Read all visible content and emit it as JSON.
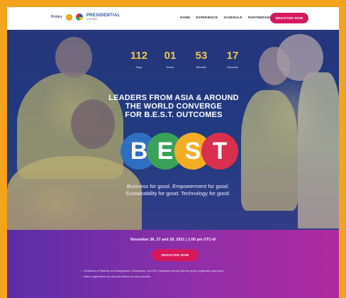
{
  "header": {
    "rotary": "Rotary",
    "brand_main": "PRESIDENTIAL",
    "brand_sub": "SUMMIT",
    "nav": [
      "HOME",
      "EXPERIENCE",
      "SCHEDULE",
      "PARTNERSHIPS"
    ],
    "register": "REGISTER NOW"
  },
  "countdown": [
    {
      "value": "112",
      "label": "Days"
    },
    {
      "value": "01",
      "label": "Hours"
    },
    {
      "value": "53",
      "label": "Minutes"
    },
    {
      "value": "17",
      "label": "Seconds"
    }
  ],
  "hero": {
    "headline_lines": [
      "LEADERS FROM ASIA & AROUND",
      "THE WORLD CONVERGE",
      "FOR B.E.S.T. OUTCOMES"
    ],
    "best_letters": [
      "B",
      "E",
      "S",
      "T"
    ],
    "tagline_lines": [
      "Business for good. Empowerment for good.",
      "Sustainability for good. Technology for good."
    ]
  },
  "band": {
    "date": "November 26, 27 and 28, 2021 | 1:00 pm UTC+8",
    "register": "REGISTER NOW",
    "notes": [
      "Residents of Pakistan and Bangladesh, Rotaractors, and RCC delegates should take the group registration approach.",
      "Batch registrations by club and district are also possible."
    ]
  },
  "colors": {
    "frame": "#f4a31c",
    "accent": "#d5195e",
    "countdown": "#f1c84b",
    "band_start": "#5a2ea6",
    "band_end": "#b02a9e",
    "best_b": "#2f6fc2",
    "best_e": "#3aa158",
    "best_s": "#f3ad25",
    "best_t": "#d8304c"
  },
  "icons": [
    "rotary-wheel-icon",
    "ribbon-icon"
  ]
}
